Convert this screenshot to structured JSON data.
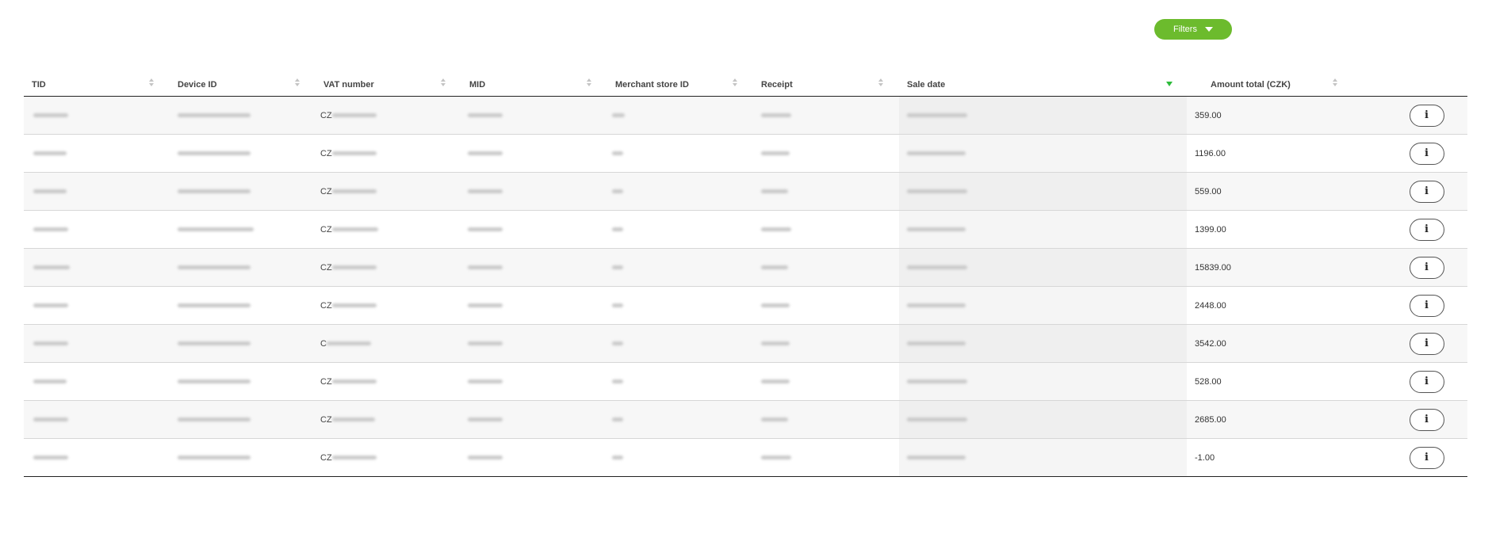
{
  "toolbar": {
    "filters_label": "Filters"
  },
  "table": {
    "columns": {
      "tid": "TID",
      "device_id": "Device ID",
      "vat_number": "VAT number",
      "mid": "MID",
      "merchant_store_id": "Merchant store ID",
      "receipt": "Receipt",
      "sale_date": "Sale date",
      "amount_total": "Amount total (CZK)"
    },
    "sorted_column": "sale_date",
    "sort_direction": "descending",
    "rows": [
      {
        "vat_prefix": "CZ",
        "amount": "359.00"
      },
      {
        "vat_prefix": "CZ",
        "amount": "1196.00"
      },
      {
        "vat_prefix": "CZ",
        "amount": "559.00"
      },
      {
        "vat_prefix": "CZ",
        "amount": "1399.00"
      },
      {
        "vat_prefix": "CZ",
        "amount": "15839.00"
      },
      {
        "vat_prefix": "CZ",
        "amount": "2448.00"
      },
      {
        "vat_prefix": "C",
        "amount": "3542.00"
      },
      {
        "vat_prefix": "CZ",
        "amount": "528.00"
      },
      {
        "vat_prefix": "CZ",
        "amount": "2685.00"
      },
      {
        "vat_prefix": "CZ",
        "amount": "-1.00"
      }
    ],
    "info_button_icon": "info-icon",
    "accent_color": "#6cbb2d",
    "sort_active_color": "#2dbb3b"
  }
}
